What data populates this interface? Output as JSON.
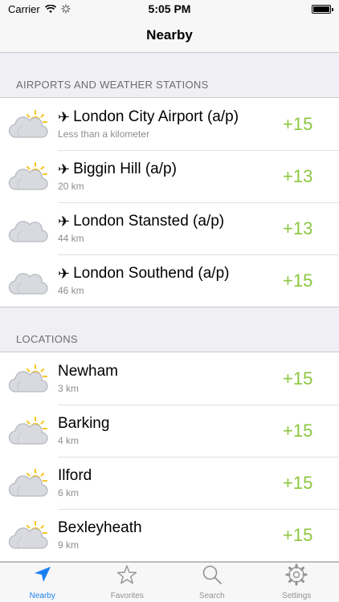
{
  "status": {
    "carrier": "Carrier",
    "time": "5:05 PM"
  },
  "nav": {
    "title": "Nearby"
  },
  "sections": [
    {
      "header": "AIRPORTS AND WEATHER STATIONS",
      "items": [
        {
          "title": "London City Airport (a/p)",
          "subtitle": "Less than a kilometer",
          "temp": "+15",
          "icon": "partly-cloudy-icon",
          "plane": "✈"
        },
        {
          "title": "Biggin Hill (a/p)",
          "subtitle": "20 km",
          "temp": "+13",
          "icon": "partly-cloudy-icon",
          "plane": "✈"
        },
        {
          "title": "London Stansted (a/p)",
          "subtitle": "44 km",
          "temp": "+13",
          "icon": "cloudy-icon",
          "plane": "✈"
        },
        {
          "title": "London Southend (a/p)",
          "subtitle": "46 km",
          "temp": "+15",
          "icon": "cloudy-icon",
          "plane": "✈"
        }
      ]
    },
    {
      "header": "LOCATIONS",
      "items": [
        {
          "title": "Newham",
          "subtitle": "3 km",
          "temp": "+15",
          "icon": "partly-cloudy-icon"
        },
        {
          "title": "Barking",
          "subtitle": "4 km",
          "temp": "+15",
          "icon": "partly-cloudy-icon"
        },
        {
          "title": "Ilford",
          "subtitle": "6 km",
          "temp": "+15",
          "icon": "partly-cloudy-icon"
        },
        {
          "title": "Bexleyheath",
          "subtitle": "9 km",
          "temp": "+15",
          "icon": "partly-cloudy-icon"
        }
      ]
    }
  ],
  "tabs": [
    {
      "label": "Nearby",
      "icon": "location-arrow-icon",
      "active": true
    },
    {
      "label": "Favorites",
      "icon": "star-icon",
      "active": false
    },
    {
      "label": "Search",
      "icon": "search-icon",
      "active": false
    },
    {
      "label": "Settings",
      "icon": "gear-icon",
      "active": false
    }
  ],
  "colors": {
    "accent": "#1a7ff5",
    "temperature": "#8dc63f",
    "sun": "#f7c51e",
    "cloud": "#d8dadf"
  }
}
